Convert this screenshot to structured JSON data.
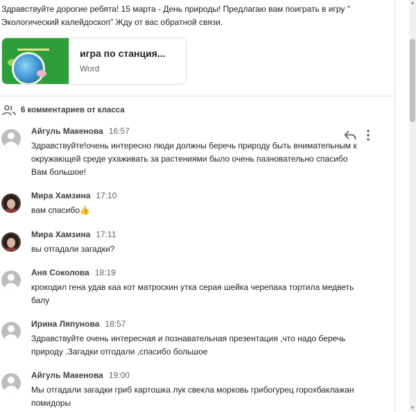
{
  "post": {
    "text": "Здравствуйте дорогие ребята! 15 марта - День природы! Предлагаю вам поиграть в игру \" Экологический калейдоскоп\" Жду от вас обратной связи.",
    "attachment": {
      "title": "игра по станция...",
      "type": "Word"
    }
  },
  "comments_header": {
    "label": "6 комментариев от класса",
    "icon": "people-icon"
  },
  "comments": [
    {
      "author": "Айгуль Макенова",
      "time": "16:57",
      "text": "Здравствуйте!очень интересно люди должны беречь природу быть внимательным к окружающей среде ухаживать за растениями было очень пазновательно спасибо Вам большое!",
      "avatar": "default"
    },
    {
      "author": "Мира Хамзина",
      "time": "17:10",
      "text": "вам спасибо👍",
      "avatar": "photo"
    },
    {
      "author": "Мира Хамзина",
      "time": "17:11",
      "text": "вы отгадали загадки?",
      "avatar": "photo"
    },
    {
      "author": "Аня Соколова",
      "time": "18:19",
      "text": "крокодил  гена удав  каа  кот  матроскин   утка серая  шейка   черепаха тортила медветь балу",
      "avatar": "default"
    },
    {
      "author": "Ирина Ляпунова",
      "time": "18:57",
      "text": "Здравствуйте  очень интересная  и познавательная презентация ,что надо беречь природу .Загадки отгодали ,спасибо большое",
      "avatar": "default"
    },
    {
      "author": "Айгуль Макенова",
      "time": "19:00",
      "text": "Мы отгадали загадки гриб картошка лук свекла морковь грибогурец горохбаклажан помидоры",
      "avatar": "default"
    }
  ],
  "icons": {
    "reply": "reply-icon",
    "more": "more-vert-icon"
  },
  "colors": {
    "thumbnail_green": "#2e9e3a",
    "divider": "#e0e0e0",
    "secondary_text": "#5f6368"
  }
}
